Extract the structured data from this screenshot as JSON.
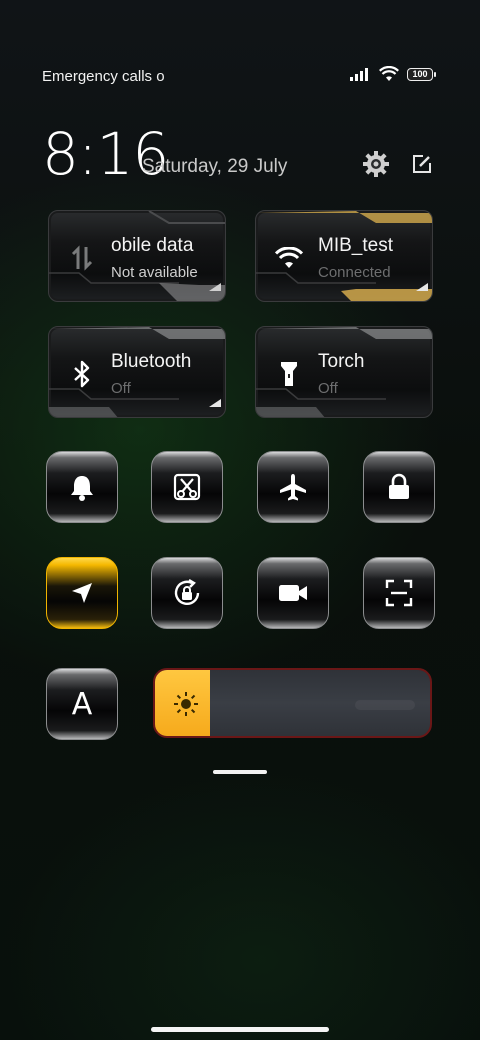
{
  "status_bar": {
    "carrier_text": "Emergency calls o",
    "battery_level": "100",
    "signal_icon": "signal-bars-icon",
    "wifi_icon": "wifi-icon"
  },
  "header": {
    "time": "8:16",
    "date": "Saturday, 29 July",
    "settings_icon": "gear-icon",
    "edit_icon": "edit-icon"
  },
  "tiles": [
    {
      "title": "obile data",
      "subtitle": "Not available",
      "icon": "mobile-data-icon",
      "active": false
    },
    {
      "title": "MIB_test",
      "subtitle": "Connected",
      "icon": "wifi-icon",
      "active": true
    },
    {
      "title": "Bluetooth",
      "subtitle": "Off",
      "icon": "bluetooth-icon",
      "active": false
    },
    {
      "title": "Torch",
      "subtitle": "Off",
      "icon": "torch-icon",
      "active": false
    }
  ],
  "toggles": [
    {
      "icon": "bell-icon",
      "active": false
    },
    {
      "icon": "screenshot-icon",
      "active": false
    },
    {
      "icon": "airplane-icon",
      "active": false
    },
    {
      "icon": "lock-icon",
      "active": false
    },
    {
      "icon": "location-icon",
      "active": true
    },
    {
      "icon": "rotation-lock-icon",
      "active": false
    },
    {
      "icon": "video-camera-icon",
      "active": false
    },
    {
      "icon": "scan-icon",
      "active": false
    }
  ],
  "font_button": {
    "label": "A"
  },
  "brightness": {
    "level": 0.2,
    "icon": "sun-icon"
  },
  "colors": {
    "accent": "#f6aa1c",
    "gold": "#c9a24a",
    "slider_border": "#6a1717"
  }
}
